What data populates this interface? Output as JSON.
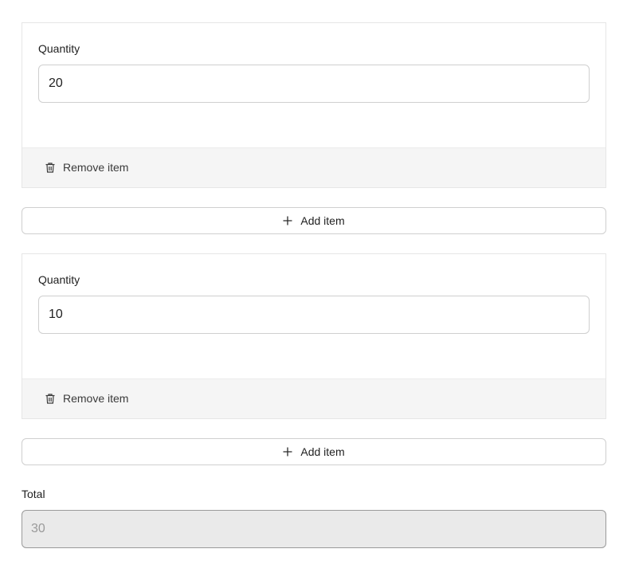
{
  "items": [
    {
      "quantity_label": "Quantity",
      "quantity_value": "20",
      "remove_label": "Remove item"
    },
    {
      "quantity_label": "Quantity",
      "quantity_value": "10",
      "remove_label": "Remove item"
    }
  ],
  "add_item_label": "Add item",
  "total": {
    "label": "Total",
    "value": "30"
  },
  "icons": {
    "remove": "trash-icon",
    "add": "plus-icon"
  },
  "colors": {
    "card_footer_bg": "#f5f5f5",
    "total_field_bg": "#eaeaea",
    "text": "#1f1f1f"
  }
}
